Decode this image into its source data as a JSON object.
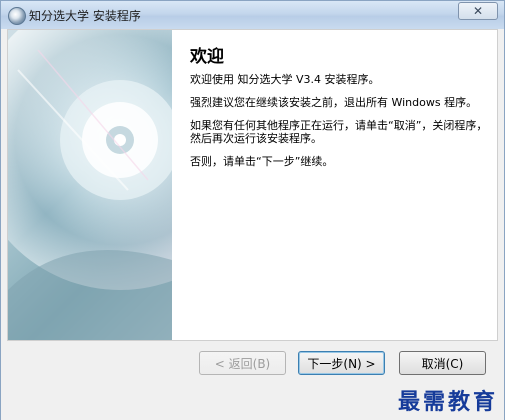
{
  "window": {
    "title": "知分选大学 安装程序",
    "close_symbol": "✕"
  },
  "welcome": {
    "heading": "欢迎",
    "line1": "欢迎使用 知分选大学 V3.4 安装程序。",
    "line2": "强烈建议您在继续该安装之前，退出所有 Windows 程序。",
    "line3": "如果您有任何其他程序正在运行，请单击“取消”，关闭程序，然后再次运行该安装程序。",
    "line4": "否则，请单击“下一步”继续。"
  },
  "buttons": {
    "back": "< 返回(B)",
    "next": "下一步(N) >",
    "cancel": "取消(C)"
  },
  "watermark": "最需教育",
  "icons": {
    "title": "installer-disc-icon",
    "close": "close-icon"
  },
  "colors": {
    "watermark": "#163b9a",
    "title_bar": "#c3d6ec"
  }
}
